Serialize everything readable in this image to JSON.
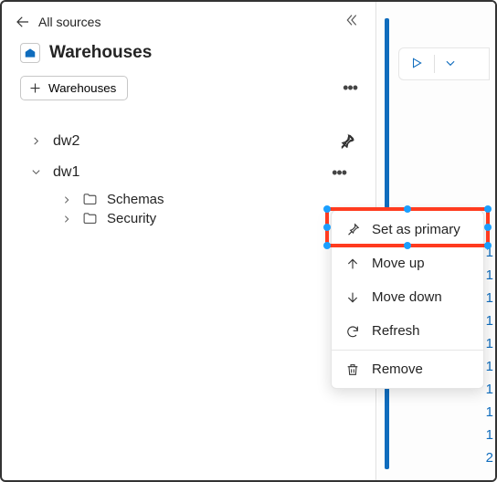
{
  "header": {
    "back_label": "All sources"
  },
  "title": "Warehouses",
  "add_button": {
    "label": "Warehouses"
  },
  "tree": {
    "items": [
      {
        "label": "dw2",
        "expanded": false
      },
      {
        "label": "dw1",
        "expanded": true,
        "children": [
          {
            "label": "Schemas"
          },
          {
            "label": "Security"
          }
        ]
      }
    ]
  },
  "context_menu": {
    "items": [
      {
        "icon": "pin-icon",
        "label": "Set as primary"
      },
      {
        "icon": "arrow-up-icon",
        "label": "Move up"
      },
      {
        "icon": "arrow-down-icon",
        "label": "Move down"
      },
      {
        "icon": "refresh-icon",
        "label": "Refresh"
      },
      {
        "icon": "trash-icon",
        "label": "Remove"
      }
    ]
  },
  "line_numbers": [
    "1",
    "1",
    "1",
    "1",
    "1",
    "1",
    "1",
    "1",
    "1",
    "2"
  ]
}
